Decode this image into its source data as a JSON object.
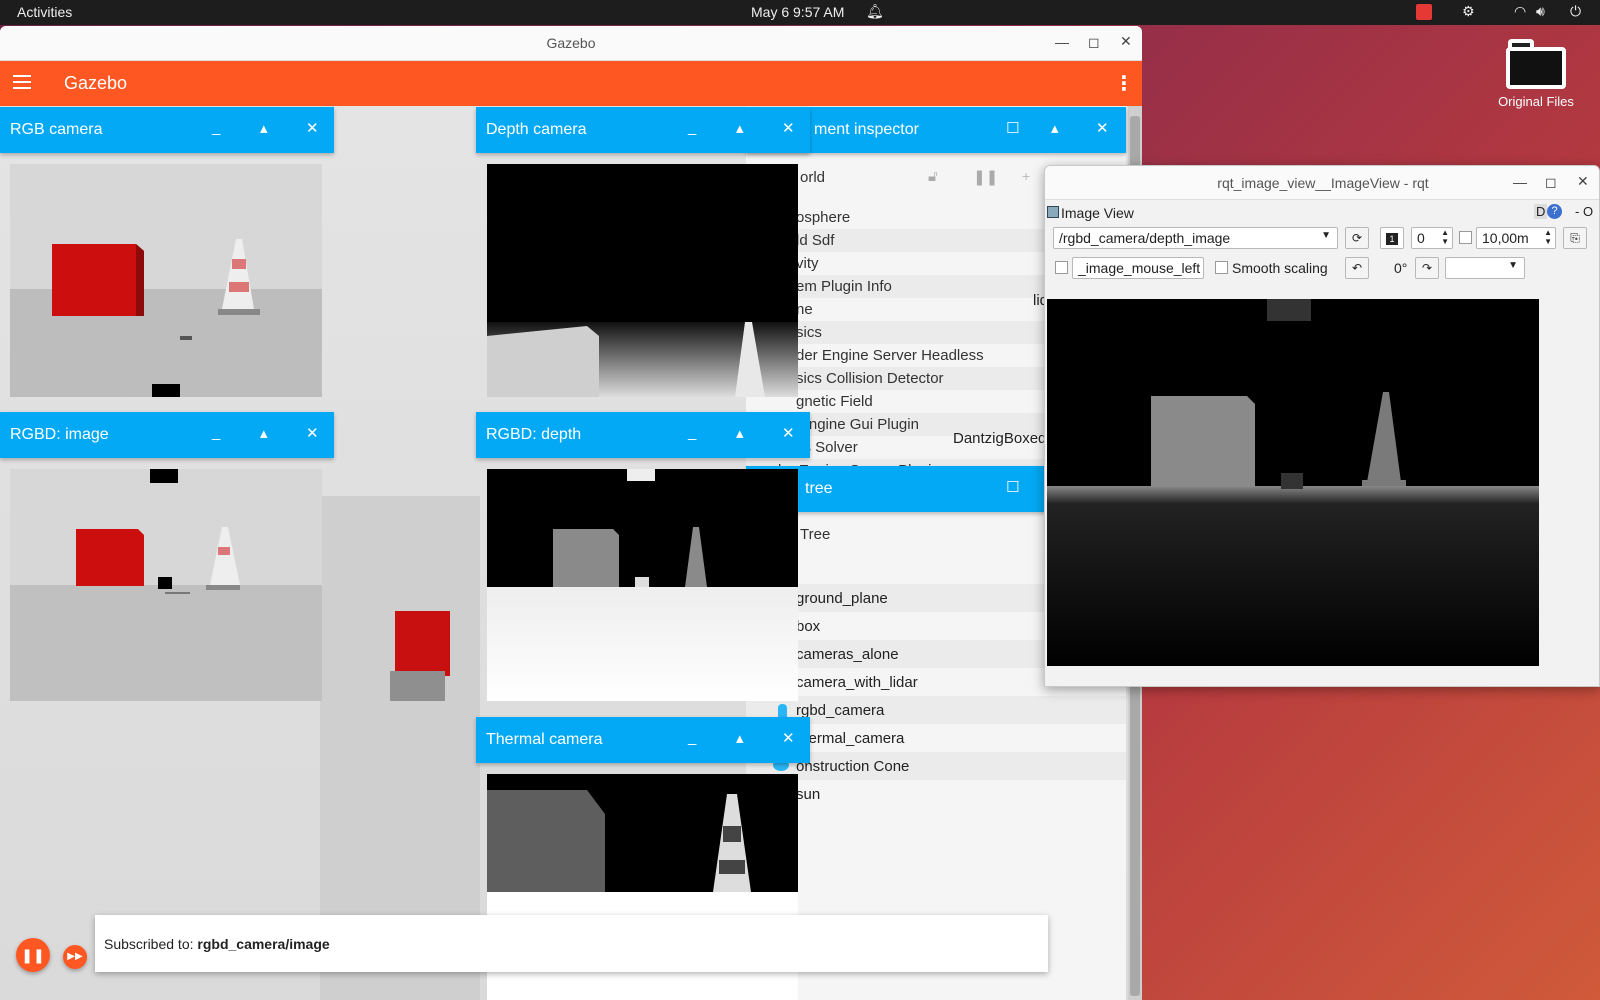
{
  "system_bar": {
    "activities": "Activities",
    "clock": "May 6  9:57 AM"
  },
  "desktop": {
    "icon_label": "Original Files"
  },
  "gazebo": {
    "window_title": "Gazebo",
    "app_title": "Gazebo",
    "accent": "#fe5722",
    "card_color": "#03a9f4",
    "cards": {
      "rgb": "RGB camera",
      "depth": "Depth camera",
      "inspector": "ment inspector",
      "rgbd_image": "RGBD: image",
      "rgbd_depth": "RGBD: depth",
      "tree": "tree",
      "thermal": "Thermal camera"
    },
    "inspector": {
      "world": "orld",
      "rows": [
        "osphere",
        "ld Sdf",
        "vity",
        "em Plugin Info",
        "ne",
        "sics",
        "der Engine Server Headless",
        "sics Collision Detector",
        "gnetic Field",
        "der Engine Gui Plugin",
        "cs Solver",
        "der Engine Server Plugin"
      ],
      "name_value": "lid",
      "solver_value": "DantzigBoxed"
    },
    "tree": {
      "header": "Tree",
      "items": [
        "ground_plane",
        "box",
        "cameras_alone",
        "camera_with_lidar",
        "rgbd_camera",
        "thermal_camera",
        "onstruction Cone",
        "sun"
      ]
    },
    "toast": {
      "prefix": "Subscribed to: ",
      "topic": "rgbd_camera/image"
    }
  },
  "rqt": {
    "window_title": "rqt_image_view__ImageView - rqt",
    "plugin_title": "Image View",
    "plugin_badge": "D",
    "plugin_controls": "- O",
    "topic": "/rgbd_camera/depth_image",
    "min_value": "0",
    "max_value": "10,00m",
    "mouse_topic": "_image_mouse_left",
    "smooth_label": "Smooth scaling",
    "rotation": "0°"
  }
}
